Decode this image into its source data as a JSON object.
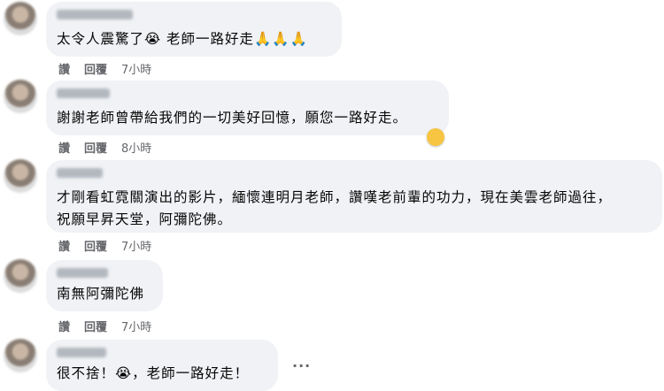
{
  "comments": [
    {
      "text": "太令人震驚了😭 老師一路好走🙏🙏🙏",
      "line2": "",
      "time": "7小時"
    },
    {
      "text": "謝謝老師曾帶給我們的一切美好回憶，願您一路好走。",
      "line2": "",
      "time": "8小時"
    },
    {
      "text": "才剛看虹霓關演出的影片，緬懷連明月老師，讚嘆老前輩的功力，現在美雲老師過往，",
      "line2": "祝願早昇天堂，阿彌陀佛。",
      "time": "7小時"
    },
    {
      "text": "南無阿彌陀佛",
      "line2": "",
      "time": "7小時"
    },
    {
      "text": "很不捨！😭，老師一路好走！",
      "line2": "",
      "time": ""
    }
  ],
  "actions": {
    "like": "讚",
    "reply": "回覆"
  },
  "icons": {
    "more": "more-options-icon",
    "reaction": "crying-face-icon"
  },
  "colors": {
    "bubble": "#f0f2f5",
    "meta": "#65676b",
    "text": "#050505"
  }
}
